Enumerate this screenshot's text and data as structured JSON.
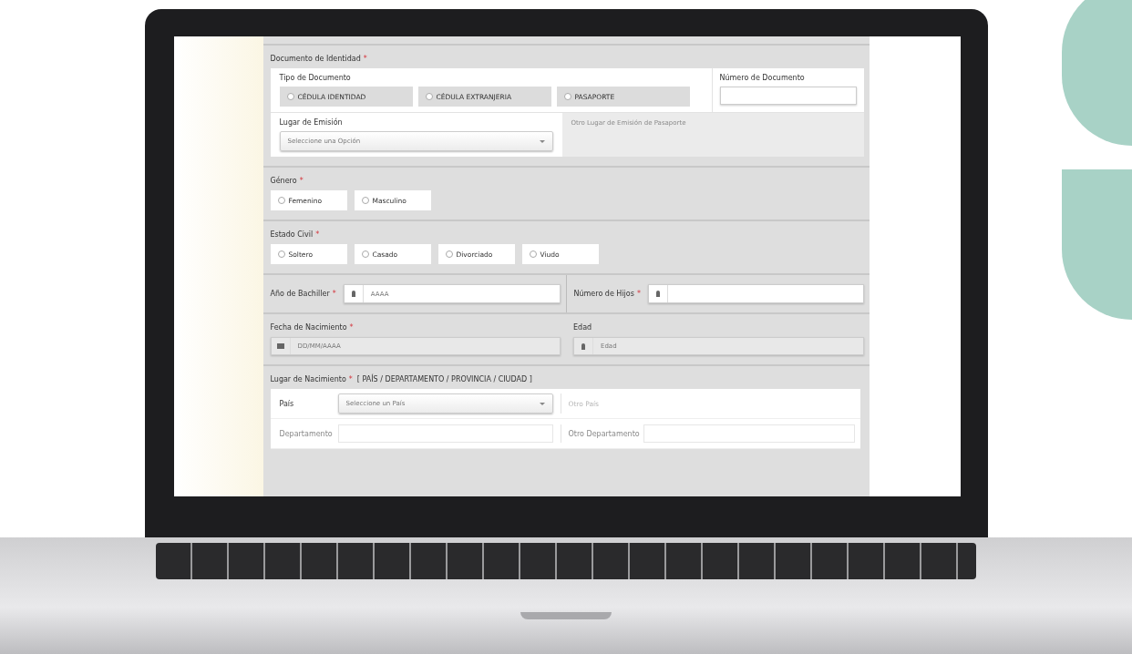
{
  "document": {
    "title": "Documento de Identidad",
    "required_mark": "*",
    "type_label": "Tipo de Documento",
    "types": [
      {
        "label": "CÉDULA IDENTIDAD",
        "selected": false
      },
      {
        "label": "CÉDULA EXTRANJERIA",
        "selected": false
      },
      {
        "label": "PASAPORTE",
        "selected": false
      }
    ],
    "number_label": "Número de Documento",
    "issue_label": "Lugar de Emisión",
    "issue_placeholder": "Seleccione una Opción",
    "other_issue": {
      "placeholder": "Otro Lugar de Emisión de Pasaporte",
      "disabled": true
    }
  },
  "gender": {
    "title": "Género",
    "required_mark": "*",
    "options": [
      {
        "label": "Femenino",
        "selected": false
      },
      {
        "label": "Masculino",
        "selected": false
      }
    ]
  },
  "marital_status": {
    "title": "Estado Civil",
    "required_mark": "*",
    "options": [
      {
        "label": "Soltero",
        "selected": false
      },
      {
        "label": "Casado",
        "selected": false
      },
      {
        "label": "Divorciado",
        "selected": false
      },
      {
        "label": "Viudo",
        "selected": false
      }
    ]
  },
  "graduation_year": {
    "label": "Año de Bachiller",
    "required_mark": "*",
    "placeholder": "AAAA",
    "disabled": false
  },
  "children_count": {
    "label": "Número de Hijos",
    "required_mark": "*",
    "disabled": false
  },
  "birth_date": {
    "label": "Fecha de Nacimiento",
    "required_mark": "*",
    "placeholder": "DD/MM/AAAA",
    "disabled": true
  },
  "age": {
    "label": "Edad",
    "placeholder": "Edad",
    "disabled": true
  },
  "birthplace": {
    "title": "Lugar de Nacimiento",
    "required_mark": "*",
    "hint": "[ PAÍS / DEPARTAMENTO / PROVINCIA / CIUDAD ]",
    "rows": [
      {
        "label": "País",
        "placeholder": "Seleccione un País",
        "kind": "select",
        "disabled": false,
        "other": "Otro País"
      },
      {
        "label": "Departamento",
        "kind": "text",
        "disabled": true,
        "other": "Otro Departamento"
      }
    ]
  }
}
